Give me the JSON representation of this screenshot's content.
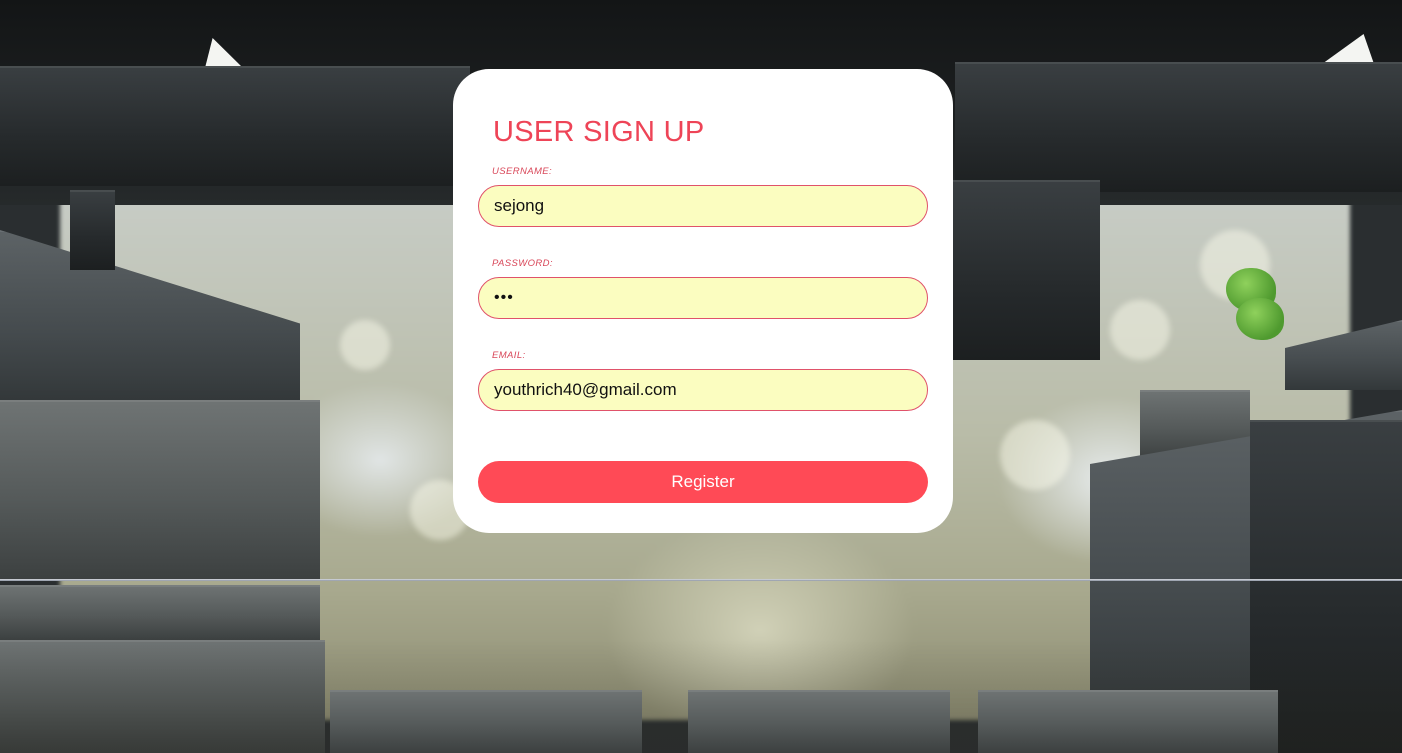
{
  "signup": {
    "title": "USER SIGN UP",
    "username_label": "USERNAME:",
    "username_value": "sejong",
    "password_label": "PASSWORD:",
    "password_mask": "•••",
    "email_label": "EMAIL:",
    "email_value": "youthrich40@gmail.com",
    "register_label": "Register"
  },
  "colors": {
    "accent": "#ee4457",
    "button": "#ff4a56",
    "input_bg": "#fbfdc0",
    "input_border": "#e0526a",
    "card_bg": "#ffffff"
  }
}
